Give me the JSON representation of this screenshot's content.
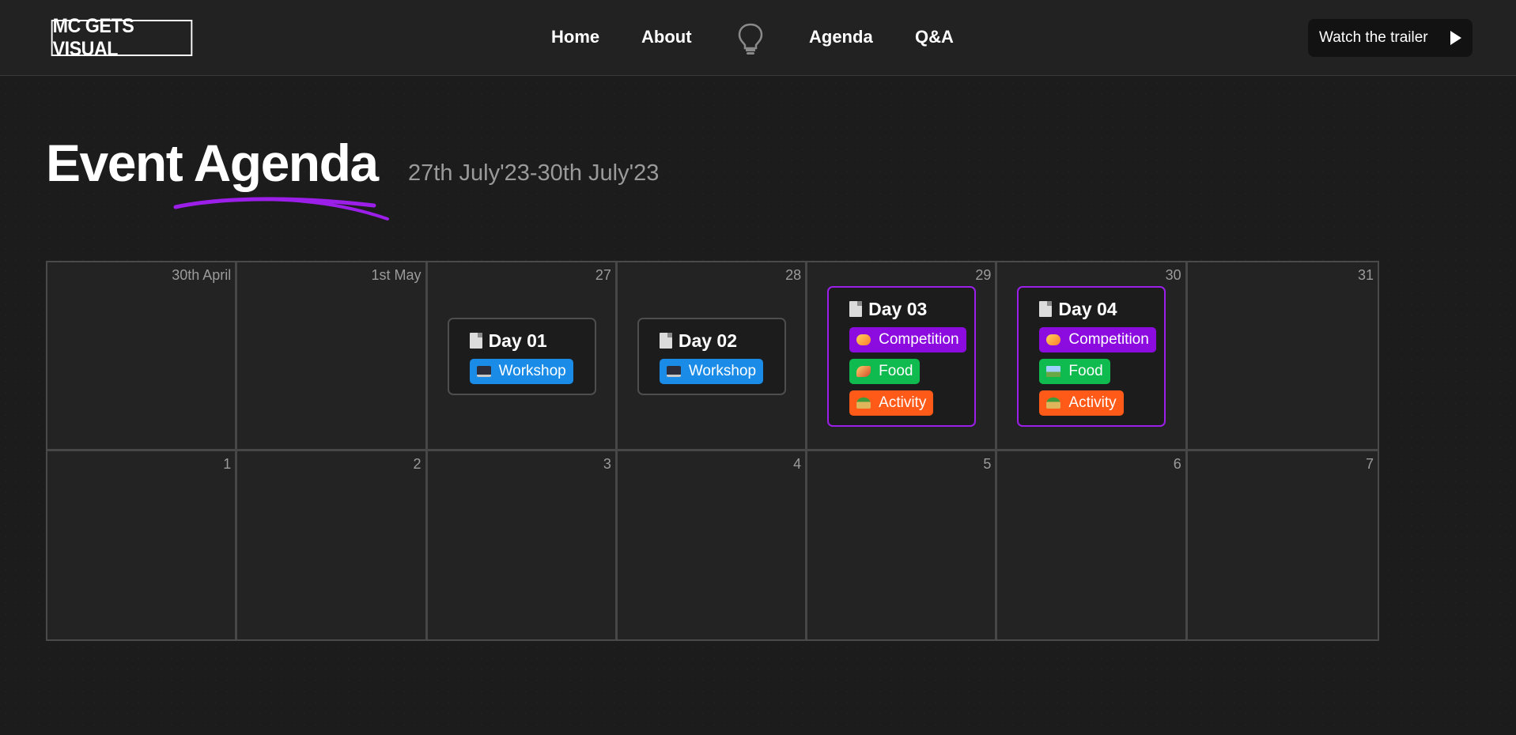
{
  "header": {
    "logo": "MC GETS VISUAL",
    "nav": [
      {
        "label": "Home"
      },
      {
        "label": "About"
      },
      {
        "label": "Agenda"
      },
      {
        "label": "Q&A"
      }
    ],
    "trailer_label": "Watch the trailer"
  },
  "page": {
    "title": "Event Agenda",
    "subtitle": "27th July'23-30th July'23",
    "accent_color": "#9b1fe8"
  },
  "calendar": {
    "week1": [
      {
        "date": "30th April"
      },
      {
        "date": "1st May"
      },
      {
        "date": "27",
        "event": {
          "title": "Day 01",
          "tags": [
            "Workshop"
          ]
        }
      },
      {
        "date": "28",
        "event": {
          "title": "Day 02",
          "tags": [
            "Workshop"
          ]
        }
      },
      {
        "date": "29",
        "event": {
          "title": "Day 03",
          "tags": [
            "Competition",
            "Food",
            "Activity"
          ]
        }
      },
      {
        "date": "30",
        "event": {
          "title": "Day 04",
          "tags": [
            "Competition",
            "Food",
            "Activity"
          ]
        }
      },
      {
        "date": "31"
      }
    ],
    "week2": [
      {
        "date": "1"
      },
      {
        "date": "2"
      },
      {
        "date": "3"
      },
      {
        "date": "4"
      },
      {
        "date": "5"
      },
      {
        "date": "6"
      },
      {
        "date": "7"
      }
    ],
    "tag_colors": {
      "Workshop": "#1a8ce8",
      "Competition": "#8c0ce0",
      "Food": "#0fba4e",
      "Activity": "#ff5a18"
    }
  }
}
